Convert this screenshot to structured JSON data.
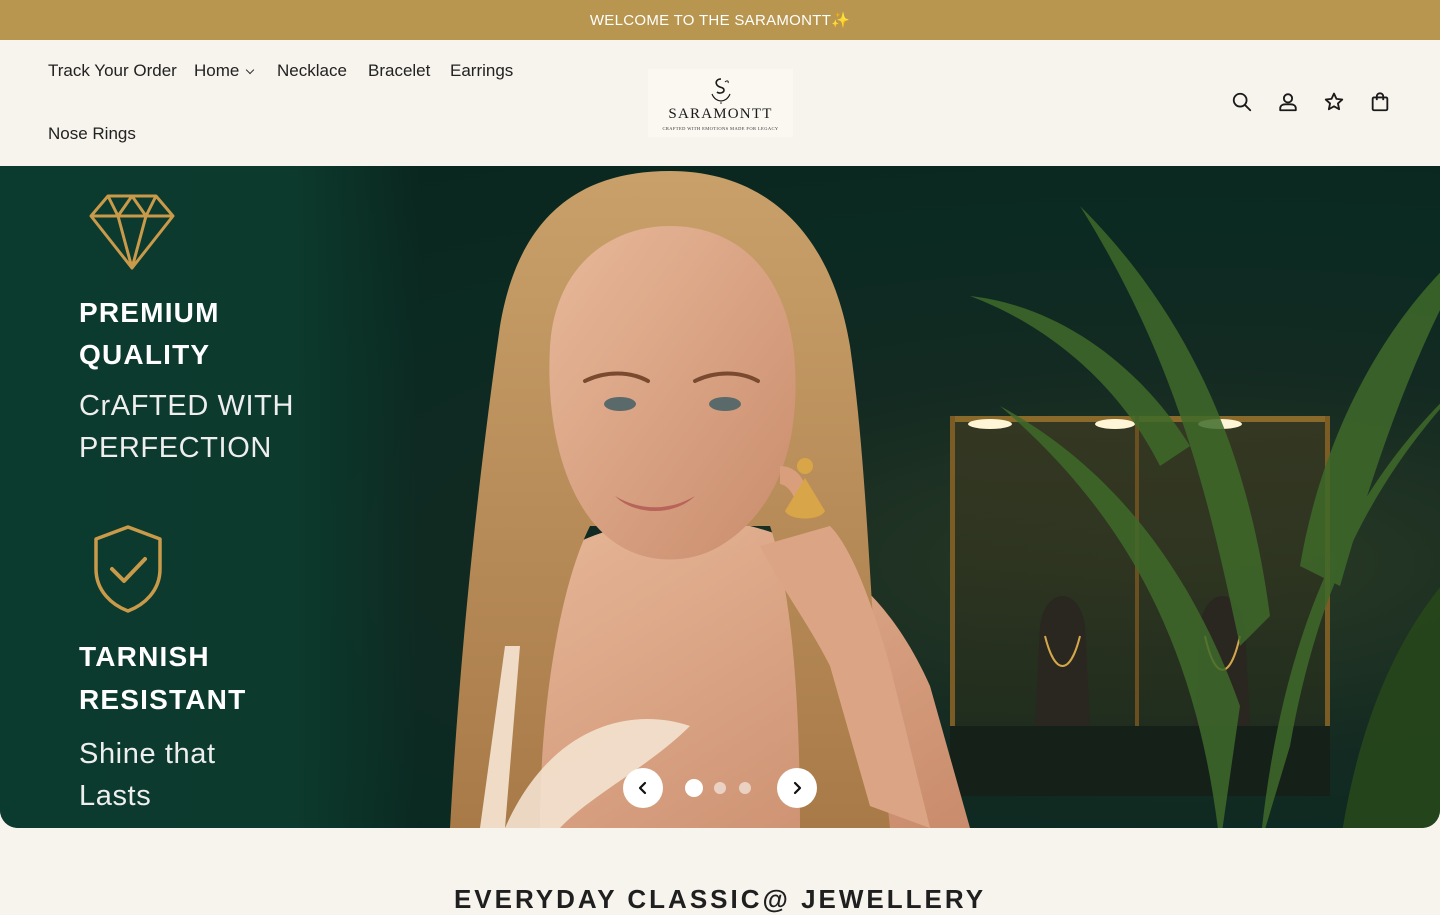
{
  "announcement": {
    "text": "WELCOME TO THE SARAMONTT✨"
  },
  "nav": {
    "items": [
      {
        "label": "Track Your Order"
      },
      {
        "label": "Home"
      },
      {
        "label": "Necklace"
      },
      {
        "label": "Bracelet"
      },
      {
        "label": "Earrings"
      },
      {
        "label": "Nose Rings"
      }
    ]
  },
  "logo": {
    "name": "SARAMONTT",
    "tagline": "Crafted with emotions made for legacy"
  },
  "header_icons": [
    "search-icon",
    "account-icon",
    "wishlist-star-icon",
    "cart-bag-icon"
  ],
  "hero": {
    "feature1": {
      "title_line1": "PREMIUM",
      "title_line2": "QUALITY",
      "sub_line1": "CrAFTED WITH",
      "sub_line2": "PERFECTION"
    },
    "feature2": {
      "title_line1": "TARNISH",
      "title_line2": "RESISTANT",
      "sub_line1": "Shine that",
      "sub_line2": "Lasts"
    },
    "slides_total": 3,
    "active_slide": 1
  },
  "section": {
    "title": "EVERYDAY CLASSIC@ JEWELLERY"
  },
  "colors": {
    "announcement_bg": "#b8964f",
    "page_bg": "#f7f3ed",
    "hero_green": "#0b3a2e",
    "gold_icon": "#c99a4a"
  }
}
